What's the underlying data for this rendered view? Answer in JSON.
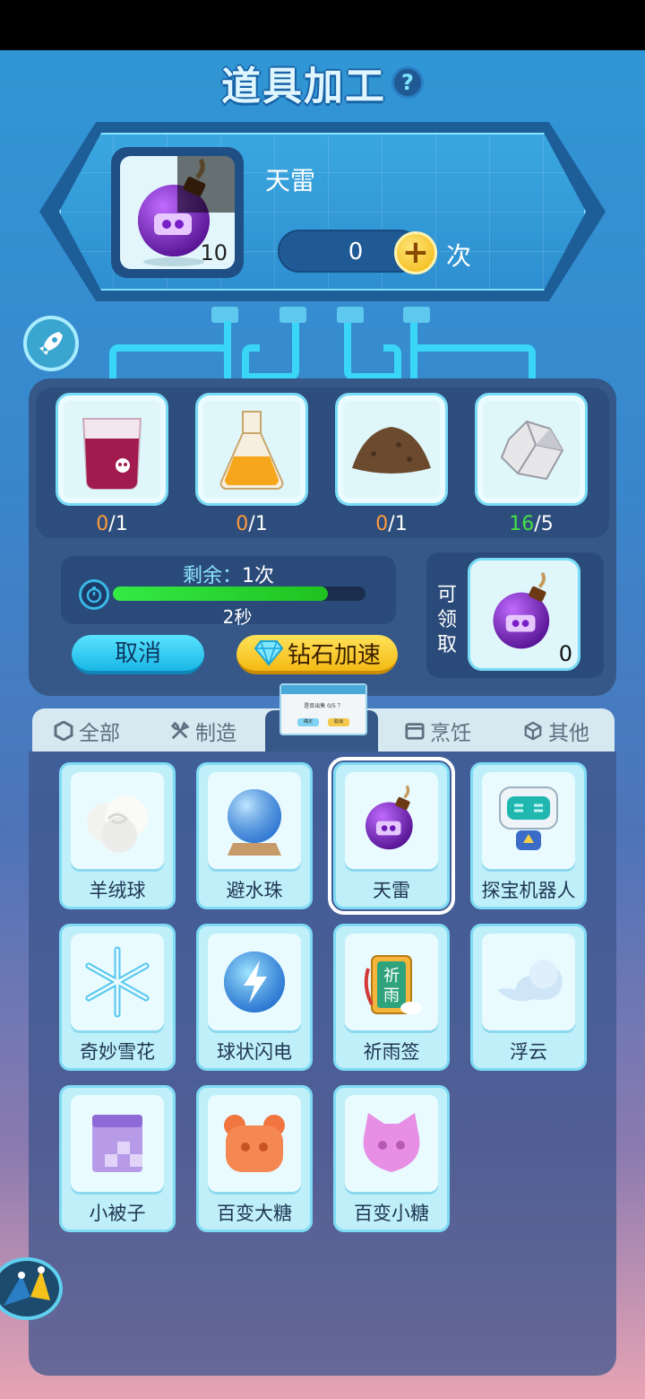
{
  "title": "道具加工",
  "help": "?",
  "product": {
    "name": "天雷",
    "owned": "10",
    "qty": "0",
    "plus": "+",
    "times": "次"
  },
  "materials": [
    {
      "have": "0",
      "need": "/1",
      "ok": false
    },
    {
      "have": "0",
      "need": "/1",
      "ok": false
    },
    {
      "have": "0",
      "need": "/1",
      "ok": false
    },
    {
      "have": "16",
      "need": "/5",
      "ok": true
    }
  ],
  "queue": {
    "remaining_label": "剩余：",
    "remaining_value": "1次",
    "progress": 0.85,
    "time_left": "2秒",
    "cancel": "取消",
    "speedup": "钻石加速"
  },
  "claim": {
    "label_lines": [
      "可",
      "领",
      "取"
    ],
    "count": "0"
  },
  "tabs": [
    "全部",
    "制造",
    "",
    "烹饪",
    "其他"
  ],
  "popup": {
    "message": "是否出售 0/5 ？",
    "confirm": "确定",
    "cancel": "取消"
  },
  "items": [
    {
      "label": "羊绒球",
      "icon": "wool-ball-icon"
    },
    {
      "label": "避水珠",
      "icon": "crystal-ball-icon"
    },
    {
      "label": "天雷",
      "icon": "bomb-icon",
      "selected": true
    },
    {
      "label": "探宝机器人",
      "icon": "robot-icon"
    },
    {
      "label": "奇妙雪花",
      "icon": "snowflake-icon"
    },
    {
      "label": "球状闪电",
      "icon": "lightning-ball-icon"
    },
    {
      "label": "祈雨签",
      "icon": "rain-charm-icon"
    },
    {
      "label": "浮云",
      "icon": "cloud-icon"
    },
    {
      "label": "小被子",
      "icon": "blanket-icon"
    },
    {
      "label": "百变大糖",
      "icon": "bear-candy-icon"
    },
    {
      "label": "百变小糖",
      "icon": "cat-candy-icon"
    }
  ],
  "colors": {
    "accent": "#39d6f7",
    "panel": "#355889",
    "gold": "#f4b914",
    "progress": "#2fd82f"
  }
}
